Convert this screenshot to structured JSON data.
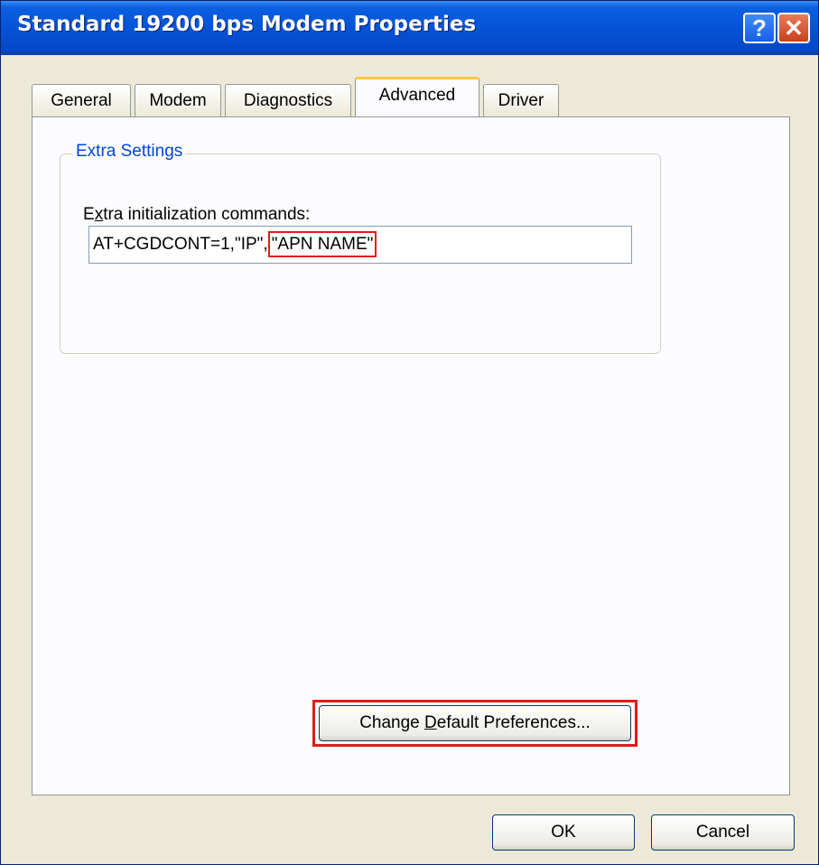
{
  "window": {
    "title": "Standard 19200 bps Modem Properties",
    "help_glyph": "?",
    "close_glyph": "✕"
  },
  "tabs": [
    {
      "label": "General",
      "active": false
    },
    {
      "label": "Modem",
      "active": false
    },
    {
      "label": "Diagnostics",
      "active": false
    },
    {
      "label": "Advanced",
      "active": true
    },
    {
      "label": "Driver",
      "active": false
    }
  ],
  "extra_settings": {
    "group_title": "Extra Settings",
    "field_label_prefix": "E",
    "field_label_accel": "x",
    "field_label_suffix": "tra initialization commands:",
    "value_prefix": "AT+CGDCONT=1,\"IP\",",
    "value_highlight": "\"APN NAME\""
  },
  "buttons": {
    "change_prefix": "Change ",
    "change_accel": "D",
    "change_suffix": "efault Preferences...",
    "ok": "OK",
    "cancel": "Cancel"
  },
  "colors": {
    "titlebar": "#0553d6",
    "highlight": "#e21b1b",
    "group_title": "#0046d5",
    "active_tab_accent": "#ffc83c"
  }
}
